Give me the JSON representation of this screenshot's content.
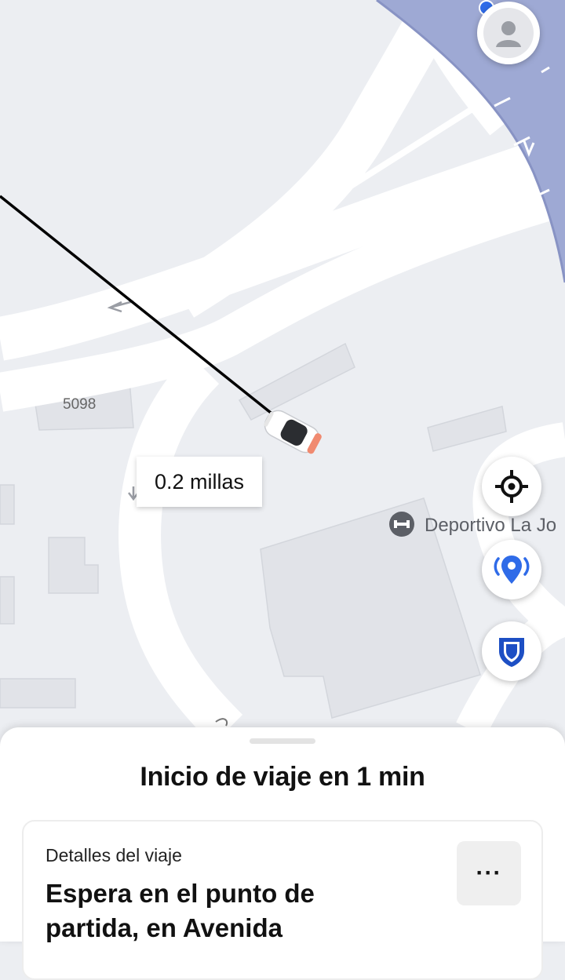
{
  "map": {
    "distance_label": "0.2 millas",
    "lot_number": "5098",
    "poi_name": "Deportivo La Jo",
    "poi_icon": "gym-dumbbell-icon",
    "car_icon": "car-icon",
    "route_color": "#000000",
    "highway_color": "#9ea9d4"
  },
  "controls": {
    "avatar_icon": "user-avatar-icon",
    "recenter_icon": "crosshair-icon",
    "location_icon": "location-broadcast-icon",
    "safety_icon": "shield-icon",
    "accent_color": "#2f6be8"
  },
  "sheet": {
    "title": "Inicio de viaje en 1 min",
    "card": {
      "label": "Detalles del viaje",
      "body": "Espera en el punto de partida, en Avenida",
      "more_label": "···"
    }
  }
}
